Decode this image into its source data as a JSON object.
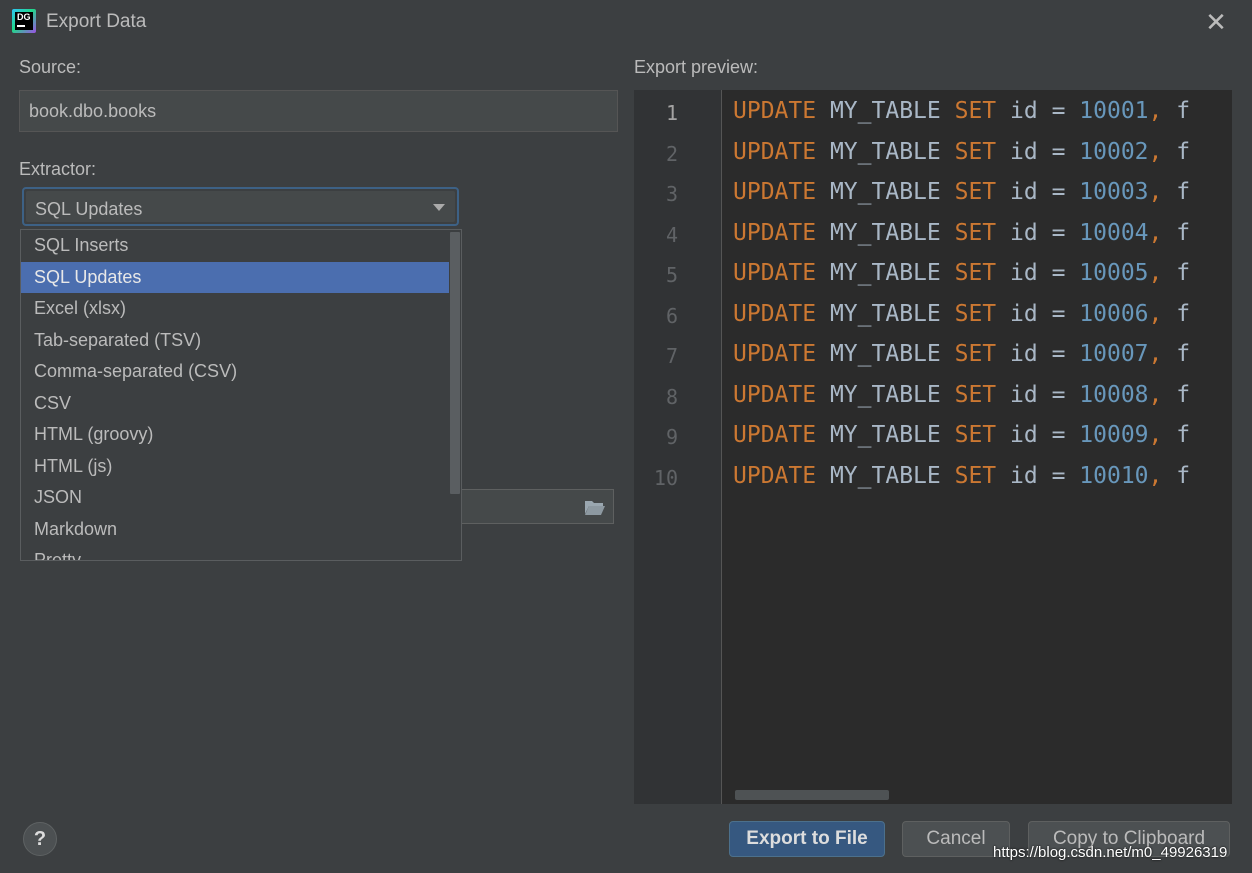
{
  "window": {
    "title": "Export Data",
    "app_icon_text": "DG",
    "close_glyph": "✕"
  },
  "source": {
    "label": "Source:",
    "value": "book.dbo.books"
  },
  "extractor": {
    "label": "Extractor:",
    "selected": "SQL Updates",
    "options": [
      "SQL Inserts",
      "SQL Updates",
      "Excel (xlsx)",
      "Tab-separated (TSV)",
      "Comma-separated (CSV)",
      "CSV",
      "HTML (groovy)",
      "HTML (js)",
      "JSON",
      "Markdown",
      "Pretty"
    ]
  },
  "preview": {
    "label": "Export preview:",
    "current_line": 1,
    "keyword_update": "UPDATE",
    "table_name": "MY_TABLE",
    "keyword_set": "SET",
    "column": "id",
    "operator": "=",
    "trailing": "f",
    "lines": [
      {
        "num": "1",
        "id_value": "10001"
      },
      {
        "num": "2",
        "id_value": "10002"
      },
      {
        "num": "3",
        "id_value": "10003"
      },
      {
        "num": "4",
        "id_value": "10004"
      },
      {
        "num": "5",
        "id_value": "10005"
      },
      {
        "num": "6",
        "id_value": "10006"
      },
      {
        "num": "7",
        "id_value": "10007"
      },
      {
        "num": "8",
        "id_value": "10008"
      },
      {
        "num": "9",
        "id_value": "10009"
      },
      {
        "num": "10",
        "id_value": "10010"
      }
    ]
  },
  "footer": {
    "help_label": "?",
    "export_to_file": "Export to File",
    "cancel": "Cancel",
    "copy_to_clipboard": "Copy to Clipboard",
    "watermark": "https://blog.csdn.net/m0_49926319"
  },
  "colors": {
    "background": "#3c3f41",
    "editor_background": "#2b2b2b",
    "keyword": "#cc7832",
    "number": "#6897bb",
    "selection": "#4b6eaf",
    "primary_button": "#365880"
  }
}
